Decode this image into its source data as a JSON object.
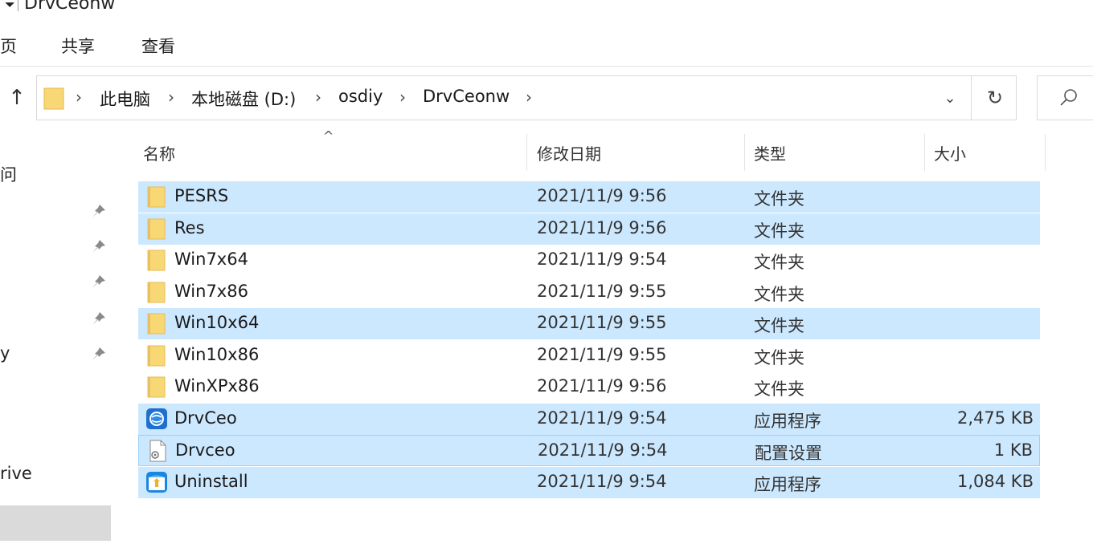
{
  "window": {
    "title": "DrvCeonw"
  },
  "ribbon": {
    "tabs": [
      "页",
      "共享",
      "查看"
    ]
  },
  "address": {
    "crumbs": [
      "此电脑",
      "本地磁盘 (D:)",
      "osdiy",
      "DrvCeonw"
    ]
  },
  "nav": {
    "fragments": [
      "问",
      "y",
      "rive"
    ]
  },
  "columns": {
    "name": "名称",
    "date": "修改日期",
    "type": "类型",
    "size": "大小"
  },
  "files": [
    {
      "name": "PESRS",
      "date": "2021/11/9 9:56",
      "type": "文件夹",
      "size": "",
      "icon": "folder-icon",
      "selected": true
    },
    {
      "name": "Res",
      "date": "2021/11/9 9:56",
      "type": "文件夹",
      "size": "",
      "icon": "folder-icon",
      "selected": true
    },
    {
      "name": "Win7x64",
      "date": "2021/11/9 9:54",
      "type": "文件夹",
      "size": "",
      "icon": "folder-icon",
      "selected": false
    },
    {
      "name": "Win7x86",
      "date": "2021/11/9 9:55",
      "type": "文件夹",
      "size": "",
      "icon": "folder-icon",
      "selected": false
    },
    {
      "name": "Win10x64",
      "date": "2021/11/9 9:55",
      "type": "文件夹",
      "size": "",
      "icon": "folder-icon",
      "selected": true
    },
    {
      "name": "Win10x86",
      "date": "2021/11/9 9:55",
      "type": "文件夹",
      "size": "",
      "icon": "folder-icon",
      "selected": false
    },
    {
      "name": "WinXPx86",
      "date": "2021/11/9 9:56",
      "type": "文件夹",
      "size": "",
      "icon": "folder-icon",
      "selected": false
    },
    {
      "name": "DrvCeo",
      "date": "2021/11/9 9:54",
      "type": "应用程序",
      "size": "2,475 KB",
      "icon": "app-globe-icon",
      "selected": true
    },
    {
      "name": "Drvceo",
      "date": "2021/11/9 9:54",
      "type": "配置设置",
      "size": "1 KB",
      "icon": "config-file-icon",
      "selected": true,
      "focus": true
    },
    {
      "name": "Uninstall",
      "date": "2021/11/9 9:54",
      "type": "应用程序",
      "size": "1,084 KB",
      "icon": "uninstall-icon",
      "selected": true
    }
  ],
  "colors": {
    "selection": "#cce8ff",
    "focus_border": "#99d1ff",
    "folder": "#f8d775"
  }
}
